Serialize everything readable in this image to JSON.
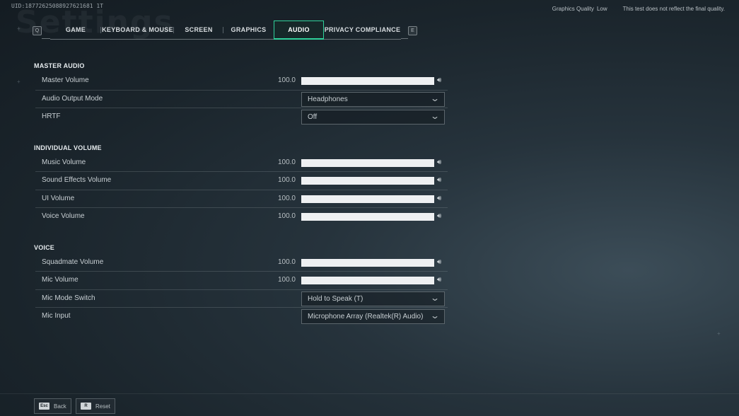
{
  "window": {
    "bg_title": "Settings",
    "uid": "UID:18772625088927621681 1T",
    "graphics_quality_label": "Graphics Quality",
    "graphics_quality_value": "Low",
    "notice": "This test does not reflect the final quality."
  },
  "tabs": {
    "prev_key": "Q",
    "next_key": "E",
    "items": [
      {
        "label": "GAME"
      },
      {
        "label": "KEYBOARD & MOUSE"
      },
      {
        "label": "SCREEN"
      },
      {
        "label": "GRAPHICS"
      },
      {
        "label": "AUDIO",
        "active": true
      },
      {
        "label": "PRIVACY COMPLIANCE"
      }
    ]
  },
  "sections": {
    "master": {
      "title": "MASTER AUDIO",
      "master_volume": {
        "label": "Master Volume",
        "value": "100.0",
        "level": 1.0
      },
      "output_mode": {
        "label": "Audio Output Mode",
        "value": "Headphones"
      },
      "hrtf": {
        "label": "HRTF",
        "value": "Off"
      }
    },
    "individual": {
      "title": "INDIVIDUAL VOLUME",
      "music": {
        "label": "Music Volume",
        "value": "100.0",
        "level": 1.0
      },
      "sfx": {
        "label": "Sound Effects Volume",
        "value": "100.0",
        "level": 1.0
      },
      "ui": {
        "label": "UI Volume",
        "value": "100.0",
        "level": 1.0
      },
      "voice": {
        "label": "Voice Volume",
        "value": "100.0",
        "level": 1.0
      }
    },
    "voice": {
      "title": "VOICE",
      "squadmate": {
        "label": "Squadmate Volume",
        "value": "100.0",
        "level": 1.0
      },
      "mic_volume": {
        "label": "Mic Volume",
        "value": "100.0",
        "level": 1.0
      },
      "mic_mode": {
        "label": "Mic Mode Switch",
        "value": "Hold to Speak (T)"
      },
      "mic_input": {
        "label": "Mic Input",
        "value": "Microphone Array (Realtek(R) Audio)"
      }
    }
  },
  "footer": {
    "back": {
      "key": "Esc",
      "label": "Back"
    },
    "reset": {
      "key": "R",
      "label": "Reset"
    }
  },
  "icons": {
    "volume": "speaker-icon",
    "dropdown": "chevron-down-icon"
  },
  "colors": {
    "accent": "#2fd29b"
  }
}
